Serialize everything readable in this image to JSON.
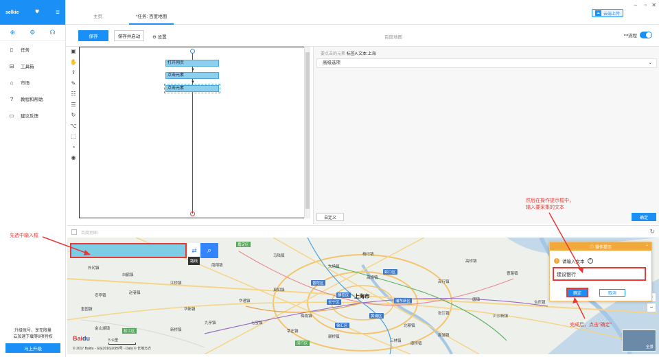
{
  "sidebar": {
    "brand": "selkie",
    "items": [
      {
        "icon": "file-icon",
        "label": "任务"
      },
      {
        "icon": "toolbox-icon",
        "label": "工具箱"
      },
      {
        "icon": "store-icon",
        "label": "市场"
      },
      {
        "icon": "help-icon",
        "label": "教程和帮助"
      },
      {
        "icon": "feedback-icon",
        "label": "建议反馈"
      }
    ],
    "upgrade_text_1": "升级账号，享无限量",
    "upgrade_text_2": "云加速下载等8项特权",
    "upgrade_button": "马上升级"
  },
  "tabs": [
    {
      "label": "主页"
    },
    {
      "label": "*任务: 百度地图"
    }
  ],
  "cloud_button": "云端上传",
  "toolbar": {
    "save_label": "保存",
    "save_start_label": "保存并启动",
    "settings_label": "设置",
    "title": "百度地图",
    "flow_label": "流程"
  },
  "flow": {
    "steps": [
      "打开网页",
      "点击元素",
      "点击元素"
    ]
  },
  "right_panel": {
    "element_label": "要点击的元素",
    "element_value": "标签A  文本:上海",
    "advanced_label": "高级选项",
    "custom_label": "自定义",
    "ok_label": "确定"
  },
  "browser": {
    "url_placeholder": "百度地图"
  },
  "map": {
    "route_tooltip": "路线",
    "city_label": "上海市",
    "labels": [
      "江桥镇",
      "真如镇",
      "大场镇",
      "杨行镇",
      "高境镇",
      "长宁区",
      "静安区",
      "黄浦区",
      "浦东新区",
      "虹口区",
      "徐汇区",
      "普陀区",
      "嘉定区",
      "闵行区",
      "松江区",
      "南翔镇",
      "九亭镇",
      "七宝镇",
      "华漕镇",
      "新桥镇",
      "赵巷镇",
      "白鹤镇",
      "外冈镇",
      "重固镇",
      "金山湖镇",
      "高行镇",
      "川沙新镇",
      "张江镇",
      "唐镇",
      "北蔡镇",
      "三林镇",
      "周浦镇",
      "康桥镇",
      "合庆镇",
      "曹路镇",
      "高桥镇",
      "莘庄镇",
      "梅陇镇",
      "颛桥镇",
      "马陆镇",
      "安亭镇",
      "华新镇"
    ],
    "copyright": "© 2017 Baidu - GS(2016)2089号 - Data © 长地万方",
    "scale_label": "5 公里",
    "pano_label": "全景"
  },
  "dialog": {
    "title": "操作提示",
    "prompt": "请输入文本",
    "input_value": "建设银行",
    "ok_label": "确定",
    "cancel_label": "取消"
  },
  "annotations": {
    "left": "先选中输入框",
    "right_top_1": "然后在操作提示框中，",
    "right_top_2": "输入要采集的文本",
    "bottom_right": "完成后，点击\"确定\""
  },
  "colors": {
    "accent": "#1a8ff5",
    "annotation": "#e53935",
    "dialog_header": "#f2a93b"
  }
}
